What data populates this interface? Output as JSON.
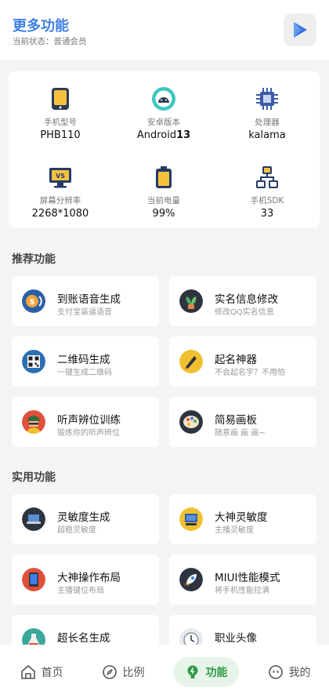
{
  "header": {
    "title": "更多功能",
    "status": "当前状态：普通会员",
    "play_icon": "play-icon"
  },
  "device_info": [
    {
      "label": "手机型号",
      "value": "PHB110",
      "value_bold": "",
      "icon": "phone-icon"
    },
    {
      "label": "安卓版本",
      "value": "Android",
      "value_bold": "13",
      "icon": "android-icon"
    },
    {
      "label": "处理器",
      "value": "kalama",
      "value_bold": "",
      "icon": "cpu-chip-icon"
    },
    {
      "label": "屏幕分辨率",
      "value": "2268*1080",
      "value_bold": "",
      "icon": "monitor-icon"
    },
    {
      "label": "当前电量",
      "value": "99%",
      "value_bold": "",
      "icon": "battery-icon"
    },
    {
      "label": "手机SDK",
      "value": "33",
      "value_bold": "",
      "icon": "sdk-network-icon"
    }
  ],
  "recommended": {
    "title": "推荐功能",
    "items": [
      {
        "title": "到账语音生成",
        "subtitle": "支付宝装逼语音",
        "icon": "payment-voice-icon"
      },
      {
        "title": "实名信息修改",
        "subtitle": "修改QQ实名信息",
        "icon": "id-plant-icon"
      },
      {
        "title": "二维码生成",
        "subtitle": "一键生成二维码",
        "icon": "qrcode-icon"
      },
      {
        "title": "起名神器",
        "subtitle": "不会起名字？不用怕",
        "icon": "name-pen-icon"
      },
      {
        "title": "听声辨位训练",
        "subtitle": "锻炼你的听声辨位",
        "icon": "soldier-icon"
      },
      {
        "title": "简易画板",
        "subtitle": "随意画 画 画~",
        "icon": "palette-icon"
      }
    ]
  },
  "practical": {
    "title": "实用功能",
    "items": [
      {
        "title": "灵敏度生成",
        "subtitle": "超稳灵敏度",
        "icon": "laptop-icon"
      },
      {
        "title": "大神灵敏度",
        "subtitle": "主播灵敏度",
        "icon": "gamepad-icon"
      },
      {
        "title": "大神操作布局",
        "subtitle": "主播键位布局",
        "icon": "tablet-icon"
      },
      {
        "title": "MIUI性能模式",
        "subtitle": "将手机性能拉满",
        "icon": "rocket-icon"
      },
      {
        "title": "超长名生成",
        "subtitle": "",
        "icon": "flask-icon"
      },
      {
        "title": "职业头像",
        "subtitle": "",
        "icon": "clock-icon"
      }
    ]
  },
  "tabs": [
    {
      "label": "首页",
      "icon": "home-icon",
      "active": false
    },
    {
      "label": "比例",
      "icon": "compass-icon",
      "active": false
    },
    {
      "label": "功能",
      "icon": "bulb-icon",
      "active": true
    },
    {
      "label": "我的",
      "icon": "smiley-icon",
      "active": false
    }
  ],
  "colors": {
    "accent": "#3f7fe6",
    "active_tab": "#2e9b45",
    "active_tab_bg": "#e6f5e8"
  }
}
